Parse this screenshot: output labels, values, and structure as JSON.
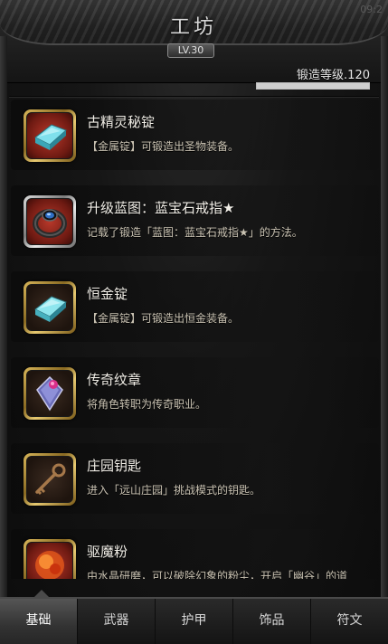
{
  "header": {
    "title": "工坊",
    "level": "LV.30",
    "top_right": "09:2"
  },
  "forge": {
    "label": "锻造等级.120",
    "progress": 1.0
  },
  "items": [
    {
      "name": "古精灵秘锭",
      "desc": "【金属锭】可锻造出圣物装备。",
      "icon": "ingot-icon",
      "frame": "gold",
      "bg": "red"
    },
    {
      "name": "升级蓝图：蓝宝石戒指★",
      "desc": "记载了锻造「蓝图：蓝宝石戒指★」的方法。",
      "icon": "sapphire-ring-icon",
      "frame": "silver",
      "bg": "red"
    },
    {
      "name": "恒金锭",
      "desc": "【金属锭】可锻造出恒金装备。",
      "icon": "ingot-icon",
      "frame": "gold",
      "bg": "dark"
    },
    {
      "name": "传奇纹章",
      "desc": "将角色转职为传奇职业。",
      "icon": "emblem-icon",
      "frame": "gold",
      "bg": "dark"
    },
    {
      "name": "庄园钥匙",
      "desc": "进入「远山庄园」挑战模式的钥匙。",
      "icon": "key-icon",
      "frame": "gold",
      "bg": "dark"
    },
    {
      "name": "驱魔粉",
      "desc": "由水晶研磨，可以破除幻象的粉尘，开启「幽谷」的道具。",
      "icon": "powder-icon",
      "frame": "gold",
      "bg": "red"
    }
  ],
  "tabs": [
    {
      "label": "基础",
      "active": true
    },
    {
      "label": "武器",
      "active": false
    },
    {
      "label": "护甲",
      "active": false
    },
    {
      "label": "饰品",
      "active": false
    },
    {
      "label": "符文",
      "active": false
    }
  ]
}
